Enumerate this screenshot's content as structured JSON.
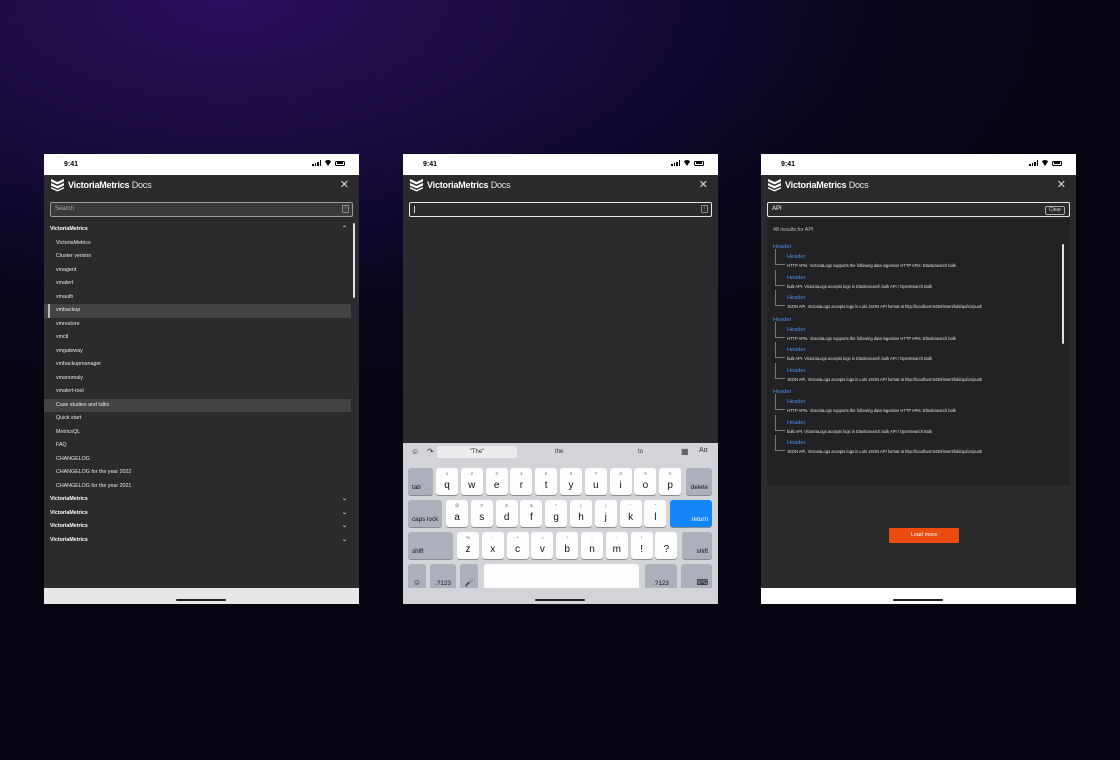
{
  "status": {
    "time": "9:41"
  },
  "app": {
    "brand": "VictoriaMetrics",
    "docs": "Docs",
    "close_glyph": "✕"
  },
  "screen1": {
    "search_placeholder": "Search",
    "search_shortcut": "/",
    "nav": [
      {
        "label": "VictoriaMetrics",
        "kind": "section",
        "chevron": "⌃"
      },
      {
        "label": "VictoriaMetrics",
        "kind": "sub"
      },
      {
        "label": "Cluster version",
        "kind": "sub"
      },
      {
        "label": "vmagent",
        "kind": "sub"
      },
      {
        "label": "vmalert",
        "kind": "sub"
      },
      {
        "label": "vmauth",
        "kind": "sub"
      },
      {
        "label": "vmbackup",
        "kind": "sub",
        "selected": true
      },
      {
        "label": "vmrestore",
        "kind": "sub"
      },
      {
        "label": "vmctl",
        "kind": "sub"
      },
      {
        "label": "vmgateway",
        "kind": "sub"
      },
      {
        "label": "vmbackupmanager",
        "kind": "sub"
      },
      {
        "label": "vmanomaly",
        "kind": "sub"
      },
      {
        "label": "vmalert-tool",
        "kind": "sub"
      },
      {
        "label": "Case studies and talks",
        "kind": "sub",
        "highlight": true
      },
      {
        "label": "Quick start",
        "kind": "sub"
      },
      {
        "label": "MetricsQL",
        "kind": "sub"
      },
      {
        "label": "FAQ",
        "kind": "sub"
      },
      {
        "label": "CHANGELOG",
        "kind": "sub"
      },
      {
        "label": "CHANGELOG for the year 2022",
        "kind": "sub"
      },
      {
        "label": "CHANGELOG for the year 2021",
        "kind": "sub"
      },
      {
        "label": "VictoriaMetrics",
        "kind": "section-collapsed",
        "chevron": "⌄"
      },
      {
        "label": "VictoriaMetrics",
        "kind": "section-collapsed",
        "chevron": "⌄"
      },
      {
        "label": "VictoriaMetrics",
        "kind": "section-collapsed",
        "chevron": "⌄"
      },
      {
        "label": "VictoriaMetrics",
        "kind": "section-collapsed",
        "chevron": "⌄"
      }
    ]
  },
  "screen2": {
    "search_shortcut": "/",
    "suggestions": [
      "\"The\"",
      "the",
      "to"
    ],
    "toolbar_glyphs": {
      "emoji": "☺",
      "redo": "↷",
      "paste": "⧉",
      "table": "▦",
      "format": "Aα"
    },
    "keys": {
      "tab": "tab",
      "delete": "delete",
      "caps": "caps lock",
      "return": "return",
      "shift": "shift",
      "num": ".?123",
      "emoji": "☺",
      "mic": "🎤",
      "hide": "⌨",
      "row1": [
        {
          "m": "q",
          "a": "1"
        },
        {
          "m": "w",
          "a": "2"
        },
        {
          "m": "e",
          "a": "3"
        },
        {
          "m": "r",
          "a": "4"
        },
        {
          "m": "t",
          "a": "5"
        },
        {
          "m": "y",
          "a": "6"
        },
        {
          "m": "u",
          "a": "7"
        },
        {
          "m": "i",
          "a": "8"
        },
        {
          "m": "o",
          "a": "9"
        },
        {
          "m": "p",
          "a": "0"
        }
      ],
      "row2": [
        {
          "m": "a",
          "a": "@"
        },
        {
          "m": "s",
          "a": "#"
        },
        {
          "m": "d",
          "a": "$"
        },
        {
          "m": "f",
          "a": "&"
        },
        {
          "m": "g",
          "a": "*"
        },
        {
          "m": "h",
          "a": "("
        },
        {
          "m": "j",
          "a": ")"
        },
        {
          "m": "k",
          "a": "'"
        },
        {
          "m": "l",
          "a": "\""
        }
      ],
      "row3": [
        {
          "m": "z",
          "a": "%"
        },
        {
          "m": "x",
          "a": "-"
        },
        {
          "m": "c",
          "a": "+"
        },
        {
          "m": "v",
          "a": "="
        },
        {
          "m": "b",
          "a": "/"
        },
        {
          "m": "n",
          "a": ";"
        },
        {
          "m": "m",
          "a": ":"
        },
        {
          "m": "!",
          "a": "!"
        },
        {
          "m": "?",
          "a": "."
        }
      ]
    }
  },
  "screen3": {
    "query": "API",
    "clear_label": "Clear",
    "results_count": "48 results for API",
    "groups": [
      {
        "header": "Header",
        "items": [
          {
            "title": "Header",
            "desc": "HTTP APIs. VictoriaLogs supports the following data ingestion HTTP APIs: Elasticsearch bulk"
          },
          {
            "title": "Header",
            "desc": "bulk API. VictoriaLogs accepts logs in Elasticsearch bulk API / OpenSearch Bulk"
          },
          {
            "title": "Header",
            "desc": "JSON API. VictoriaLogs accepts logs in Loki JSON API format at http://localhost:9428/insert/loki/api/v1/push"
          }
        ]
      },
      {
        "header": "Header",
        "items": [
          {
            "title": "Header",
            "desc": "HTTP APIs. VictoriaLogs supports the following data ingestion HTTP APIs: Elasticsearch bulk"
          },
          {
            "title": "Header",
            "desc": "bulk API. VictoriaLogs accepts logs in Elasticsearch bulk API / OpenSearch Bulk"
          },
          {
            "title": "Header",
            "desc": "JSON API. VictoriaLogs accepts logs in Loki JSON API format at http://localhost:9428/insert/loki/api/v1/push"
          }
        ]
      },
      {
        "header": "Header",
        "items": [
          {
            "title": "Header",
            "desc": "HTTP APIs. VictoriaLogs supports the following data ingestion HTTP APIs: Elasticsearch bulk"
          },
          {
            "title": "Header",
            "desc": "bulk API. VictoriaLogs accepts logs in Elasticsearch bulk API / OpenSearch Bulk"
          },
          {
            "title": "Header",
            "desc": "JSON API. VictoriaLogs accepts logs in Loki JSON API format at http://localhost:9428/insert/loki/api/v1/push"
          }
        ]
      }
    ],
    "load_more": "Load more"
  },
  "colors": {
    "accent_blue": "#4a8ff0",
    "load_more": "#ea4c0f",
    "return_key": "#1486f7"
  }
}
